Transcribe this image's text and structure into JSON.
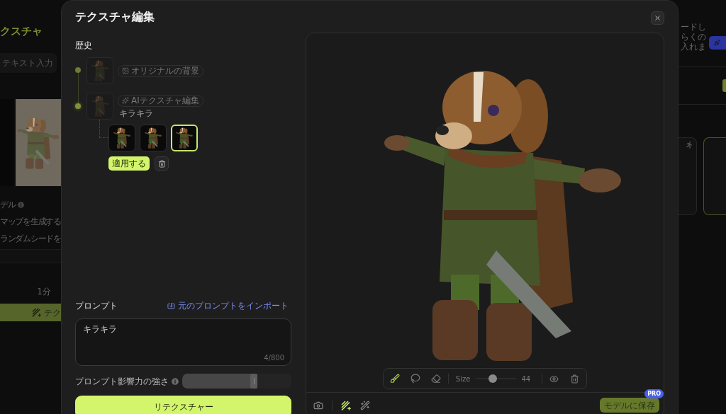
{
  "background_left_panel": {
    "title": "クスチャ",
    "input_tab": "テキスト入力",
    "options": [
      {
        "label": "デル",
        "info": true
      },
      {
        "label": "マップを生成する",
        "info": false
      },
      {
        "label": "ランダムシードを",
        "info": false
      }
    ],
    "duration": "1分",
    "generate_button": "テク"
  },
  "background_right_panel": {
    "notice_lines": [
      "ードし",
      "らくの",
      "入れま"
    ]
  },
  "dialog": {
    "title": "テクスチャ編集",
    "history": {
      "heading": "歴史",
      "items": [
        {
          "kind": "original",
          "tag": "オリジナルの背景"
        },
        {
          "kind": "ai_edit",
          "tag": "AIテクスチャ編集",
          "caption": "キラキラ",
          "variants": [
            {
              "selected": false
            },
            {
              "selected": false
            },
            {
              "selected": true
            }
          ]
        }
      ],
      "apply_button": "適用する"
    },
    "prompt": {
      "heading": "プロンプト",
      "import_link": "元のプロンプトをインポート",
      "value": "キラキラ",
      "counter": "4/800",
      "strength_label": "プロンプト影響力の強さ",
      "strength": {
        "level": 0.69
      },
      "submit_button": "リテクスチャー"
    },
    "preview": {
      "brush_tools": [
        {
          "kind": "brush",
          "selected": true
        },
        {
          "kind": "lasso",
          "selected": false
        },
        {
          "kind": "eraser",
          "selected": false
        }
      ],
      "size_label": "Size",
      "size": {
        "level": 0.4
      },
      "size_value": "44",
      "bottom_tools": [
        {
          "kind": "camera",
          "selected": false
        },
        {
          "kind": "retexture",
          "selected": true
        },
        {
          "kind": "magic",
          "selected": false
        }
      ],
      "save_button": "モデルに保存",
      "badge": "PRO"
    }
  }
}
